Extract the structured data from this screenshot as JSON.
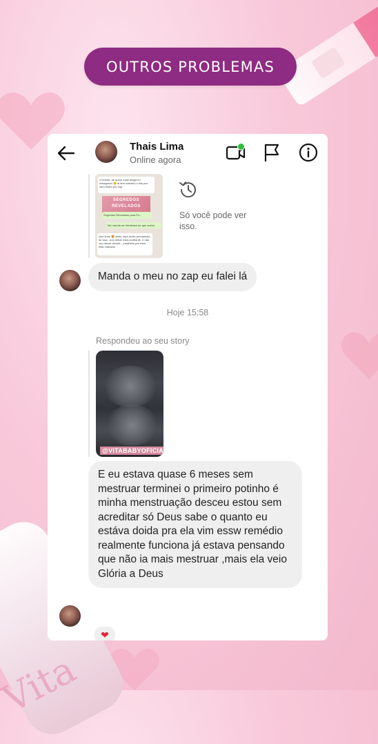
{
  "banner": {
    "title": "OUTROS PROBLEMAS"
  },
  "background": {
    "bottle_brand": "Vita"
  },
  "chat_header": {
    "contact_name": "Thais Lima",
    "status": "Online agora",
    "online_dot_color": "#2fbf3a"
  },
  "icons": {
    "back": "arrow-left-icon",
    "video": "video-call-icon",
    "flag": "flag-icon",
    "info": "info-icon",
    "history": "history-icon",
    "heart": "heart-icon"
  },
  "screenshot_preview": {
    "line1": "O brinde: de quem mais reagir no Instagram! 😊 ai tem mandou o link pra vem direto pro zap",
    "banner_line1": "SEGREDOS",
    "banner_line2": "REVELADOS",
    "file_label": "Segredos Revelados para Fo...",
    "reply_text": "Me manda um feedback do que achou",
    "bottom_text": "Que lindo 😍 amei, fava muito precisando ler isso.. nós deixei mais confiante, e não vou desse decidir... parabéns por esse lindo trabalho"
  },
  "only_you_note": "Só você pode ver isso.",
  "messages": [
    {
      "text": "Manda o meu no zap eu falei lá"
    },
    {
      "text": "E eu estava quase 6 meses sem mestruar terminei o primeiro potinho é minha menstruação desceu estou sem acreditar só Deus  sabe o quanto eu estáva doida pra ela  vim essw remédio realmente  funciona  já estava pensando que não ia mais mestruar ,mais ela veio Glória a Deus"
    }
  ],
  "timestamp": "Hoje 15:58",
  "replied_label": "Respondeu ao seu story",
  "story_brand": "@VITABABYOFICIAL",
  "reaction": "❤",
  "colors": {
    "banner_bg": "#8e2b82",
    "bubble_bg": "#efefef",
    "reaction": "#e3273a"
  }
}
